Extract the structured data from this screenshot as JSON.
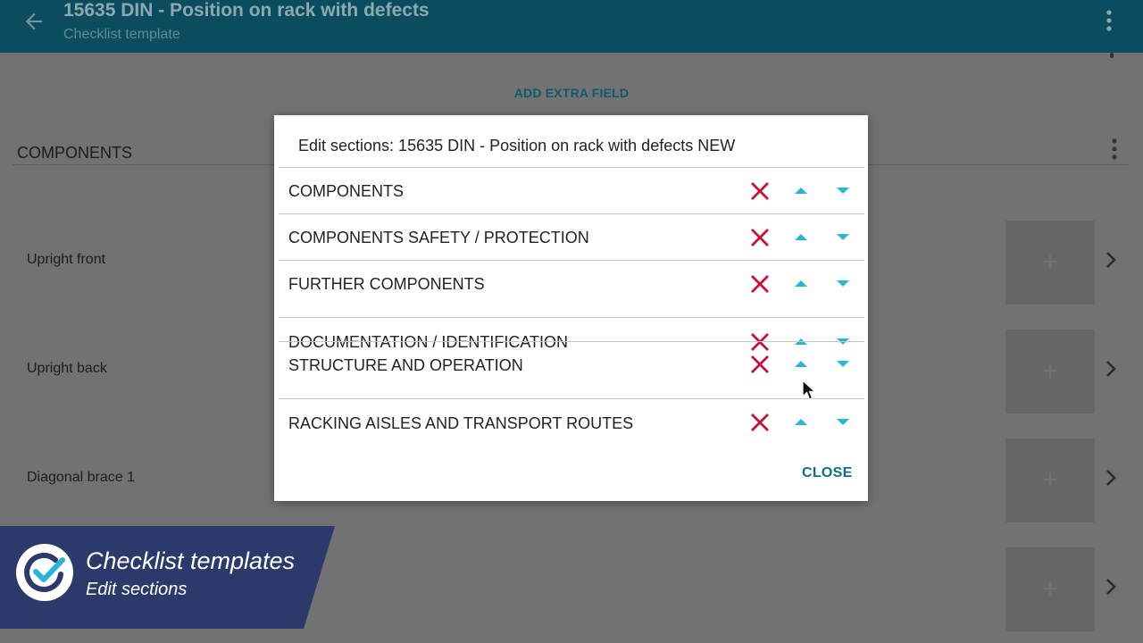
{
  "appbar": {
    "title": "15635 DIN - Position on rack with defects",
    "subtitle": "Checklist template"
  },
  "page": {
    "add_extra_field": "ADD EXTRA FIELD",
    "section_title": "COMPONENTS",
    "rows": [
      {
        "label": "Upright front"
      },
      {
        "label": "Upright back"
      },
      {
        "label": "Diagonal brace 1"
      },
      {
        "label": ""
      }
    ],
    "add_photo_glyph": "+"
  },
  "dialog": {
    "title": "Edit sections: 15635 DIN - Position on rack with defects NEW",
    "sections": [
      {
        "label": "COMPONENTS"
      },
      {
        "label": "COMPONENTS SAFETY / PROTECTION"
      },
      {
        "label": "FURTHER COMPONENTS"
      },
      {
        "label": "DOCUMENTATION / IDENTIFICATION"
      },
      {
        "label": "STRUCTURE AND OPERATION"
      },
      {
        "label": "RACKING AISLES AND TRANSPORT ROUTES"
      }
    ],
    "close_label": "CLOSE"
  },
  "overlay": {
    "title": "Checklist templates",
    "subtitle": "Edit sections"
  },
  "colors": {
    "appbar": "#0b4d5e",
    "accent": "#0e6f82",
    "delete": "#c4123a",
    "arrow": "#29b6d6",
    "badge": "#2b3a6b"
  },
  "icons": {
    "back": "arrow-left-icon",
    "menu": "more-vertical-icon",
    "delete": "close-x-icon",
    "up": "triangle-up-icon",
    "down": "triangle-down-icon",
    "chevron": "chevron-right-icon",
    "logo": "check-circle-icon"
  }
}
